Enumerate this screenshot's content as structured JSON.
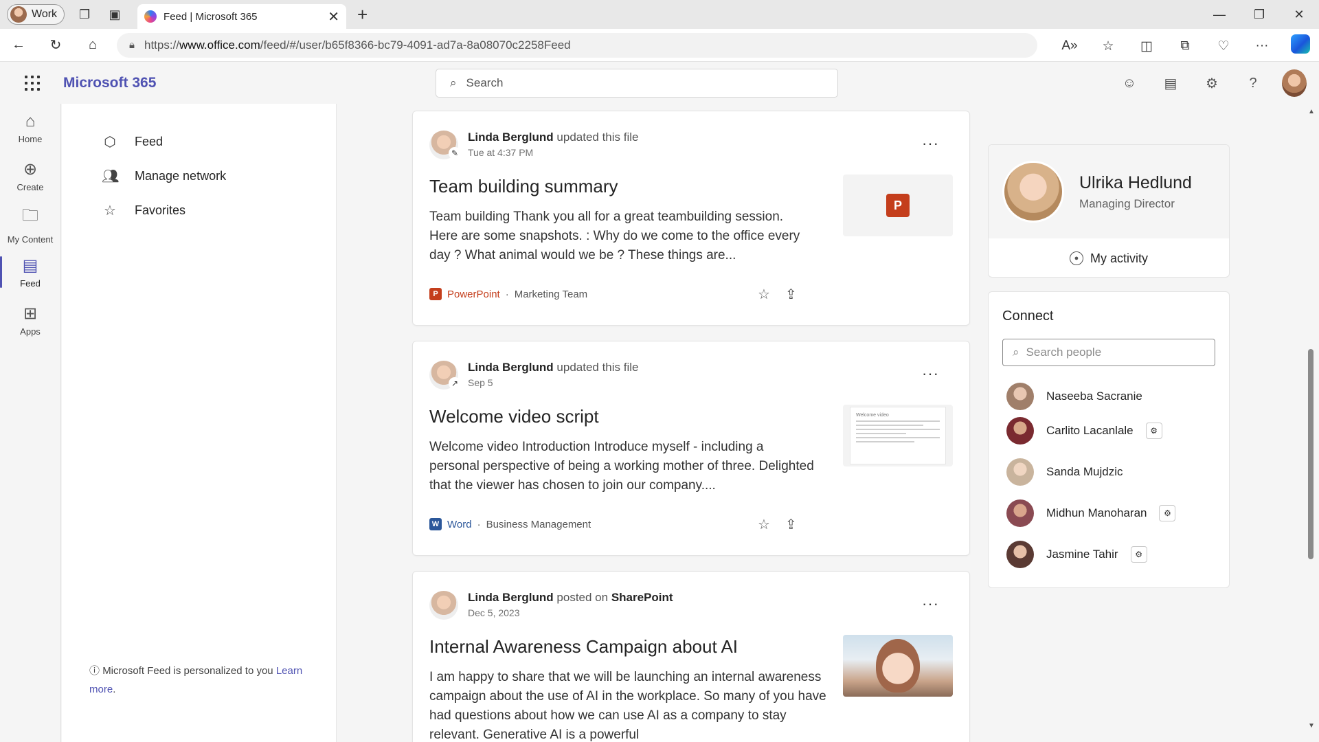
{
  "browser": {
    "profile_label": "Work",
    "tab_title": "Feed | Microsoft 365",
    "url_prefix": "https://",
    "url_host": "www.office.com",
    "url_path": "/feed/#/user/b65f8366-bc79-4091-ad7a-8a08070c2258Feed"
  },
  "header": {
    "brand": "Microsoft 365",
    "search_placeholder": "Search"
  },
  "rail": {
    "items": [
      {
        "label": "Home",
        "icon": "home-icon"
      },
      {
        "label": "Create",
        "icon": "plus-circle-icon"
      },
      {
        "label": "My Content",
        "icon": "folder-icon"
      },
      {
        "label": "Feed",
        "icon": "feed-icon",
        "active": true
      },
      {
        "label": "Apps",
        "icon": "apps-icon"
      }
    ]
  },
  "leftpanel": {
    "items": [
      {
        "label": "Feed",
        "icon": "feed-cube-icon"
      },
      {
        "label": "Manage network",
        "icon": "people-icon"
      },
      {
        "label": "Favorites",
        "icon": "star-icon"
      }
    ],
    "footer_text": "Microsoft Feed is personalized to you",
    "footer_link": "Learn more",
    "footer_end": "."
  },
  "feed": {
    "cards": [
      {
        "author": "Linda Berglund",
        "action": "updated this file",
        "time": "Tue at 4:37 PM",
        "title": "Team building summary",
        "body": "Team building Thank you all for a great teambuilding session. Here are some snapshots. : Why do we come to the office every day ? What animal would we be ? These things are...",
        "app": "PowerPoint",
        "location": "Marketing Team"
      },
      {
        "author": "Linda Berglund",
        "action": "updated this file",
        "time": "Sep 5",
        "title": "Welcome video script",
        "body": "Welcome video Introduction Introduce myself - including a personal perspective of being a working mother of three. Delighted that the viewer has chosen to join our company....",
        "app": "Word",
        "location": "Business Management",
        "thumb_heading": "Welcome video"
      },
      {
        "author": "Linda Berglund",
        "action": "posted on",
        "action_target": "SharePoint",
        "time": "Dec 5, 2023",
        "title": "Internal Awareness Campaign about AI",
        "body": "I am happy to share that we will be launching an internal awareness campaign about the use of AI in the workplace. So many of you have had questions about how we can use AI as a company to stay relevant. Generative AI is a powerful"
      }
    ]
  },
  "profile": {
    "name": "Ulrika Hedlund",
    "role": "Managing Director",
    "activity_label": "My activity"
  },
  "connect": {
    "title": "Connect",
    "search_placeholder": "Search people",
    "people": [
      {
        "name": "Naseeba Sacranie",
        "badge": false,
        "color": "#a07f6a"
      },
      {
        "name": "Carlito Lacanlale",
        "badge": true,
        "color": "#7a2a30"
      },
      {
        "name": "Sanda Mujdzic",
        "badge": false,
        "color": "#c9b49d"
      },
      {
        "name": "Midhun Manoharan",
        "badge": true,
        "color": "#8a4a52"
      },
      {
        "name": "Jasmine Tahir",
        "badge": true,
        "color": "#5a3a33"
      }
    ]
  }
}
